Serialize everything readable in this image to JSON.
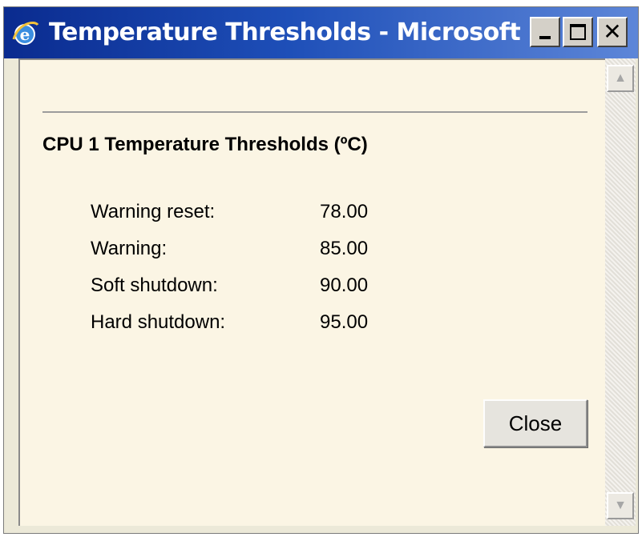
{
  "window": {
    "title": "Temperature Thresholds - Microsoft ...",
    "icon": "ie-icon",
    "controls": {
      "minimize": "minimize-icon",
      "maximize": "maximize-icon",
      "close": "close-icon"
    }
  },
  "content": {
    "heading": "CPU 1 Temperature Thresholds (ºC)",
    "thresholds": [
      {
        "label": "Warning reset:",
        "value": "78.00"
      },
      {
        "label": "Warning:",
        "value": "85.00"
      },
      {
        "label": "Soft shutdown:",
        "value": "90.00"
      },
      {
        "label": "Hard shutdown:",
        "value": "95.00"
      }
    ],
    "close_button_label": "Close"
  },
  "colors": {
    "title_bar_start": "#0a2b8f",
    "title_bar_end": "#5d86d8",
    "content_background": "#fbf5e4",
    "window_chrome": "#d4d0c8"
  }
}
